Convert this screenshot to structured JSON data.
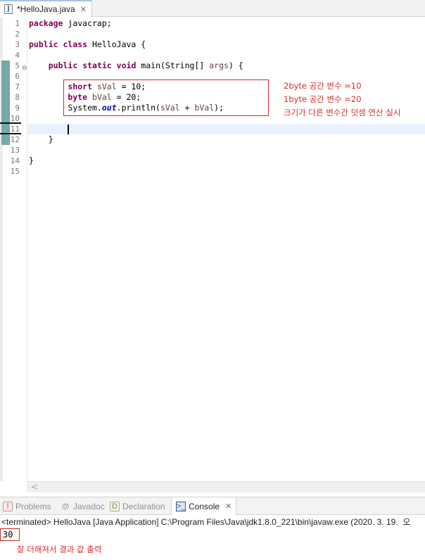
{
  "editor_tab": {
    "title": "*HelloJava.java",
    "icon": "java-file-icon",
    "close_glyph": "✕"
  },
  "line_numbers": [
    "1",
    "2",
    "3",
    "4",
    "5",
    "6",
    "7",
    "8",
    "9",
    "10",
    "11",
    "12",
    "13",
    "14",
    "15"
  ],
  "fold_marker": "⊖",
  "code": {
    "line1": {
      "kw": "package",
      "rest": " javacrap;"
    },
    "line3": {
      "kw1": "public",
      "kw2": "class",
      "rest": " HelloJava {"
    },
    "line5": {
      "kw1": "public",
      "kw2": "static",
      "kw3": "void",
      "rest1": " main(String[] ",
      "param": "args",
      "rest2": ") {"
    },
    "line7": {
      "kw": "short",
      "var": "sVal",
      "rest": " = 10;"
    },
    "line8": {
      "kw": "byte",
      "var": "bVal",
      "rest": " = 20;"
    },
    "line9": {
      "pre": "System.",
      "field": "out",
      "mid": ".println(",
      "var1": "sVal",
      "op": " + ",
      "var2": "bVal",
      "post": ");"
    },
    "line12": "}",
    "line14": "}"
  },
  "annotations": [
    "2byte 공간 변수 =10",
    "1byte 공간 변수 =20",
    "크기가 다른 변수간 덧셈 연산 실시"
  ],
  "scroll_left_glyph": "<",
  "panel_tabs": [
    {
      "label": "Problems",
      "icon": "problems-icon"
    },
    {
      "label": "Javadoc",
      "icon": "javadoc-icon",
      "glyph": "@"
    },
    {
      "label": "Declaration",
      "icon": "declaration-icon"
    },
    {
      "label": "Console",
      "icon": "console-icon",
      "active": true
    }
  ],
  "console": {
    "header": "<terminated> HelloJava [Java Application] C:\\Program Files\\Java\\jdk1.8.0_221\\bin\\javaw.exe (2020. 3. 19.  오",
    "output": "30",
    "note": "잘 더해져서 결과 값 출력"
  },
  "colors": {
    "keyword": "#7f0055",
    "local_var": "#6a3e3e",
    "static_field": "#0000c0",
    "annotation_red": "#e02b2b",
    "change_bar": "#73a9a6",
    "current_line": "#e8f2fe"
  }
}
